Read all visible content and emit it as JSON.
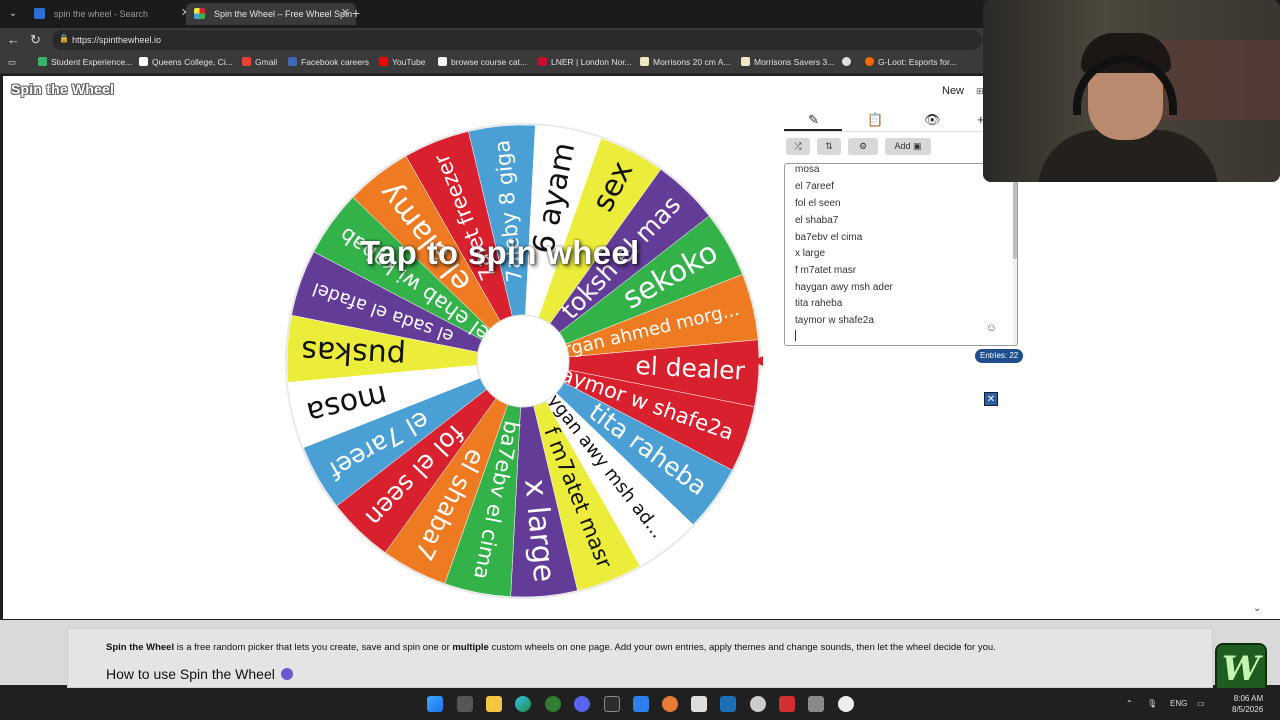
{
  "browser": {
    "tabs": [
      {
        "title": "spin the wheel - Search",
        "active": false
      },
      {
        "title": "Spin the Wheel – Free Wheel Spin",
        "active": true
      }
    ],
    "url": "https://spinthewheel.io",
    "bookmarks": [
      {
        "label": "Student Experience...",
        "color": "#3bb36a"
      },
      {
        "label": "Queens College, Ci...",
        "color": "#ffffff"
      },
      {
        "label": "Gmail",
        "color": "#ea4335"
      },
      {
        "label": "Facebook careers",
        "color": "#4267b2"
      },
      {
        "label": "YouTube",
        "color": "#ff0000"
      },
      {
        "label": "browse course cat...",
        "color": "#f5f5f5"
      },
      {
        "label": "LNER | London Nor...",
        "color": "#c8102e"
      },
      {
        "label": "Morrisons 20 cm A...",
        "color": "#f2e8c5"
      },
      {
        "label": "Morrisons Savers 3...",
        "color": "#f2e8c5"
      },
      {
        "label": "",
        "color": "#e0e0e0"
      },
      {
        "label": "G-Loot: Esports for...",
        "color": "#ff6a00"
      }
    ]
  },
  "app": {
    "logo": "Spin the Wheel",
    "new_label": "New",
    "spin_hint": "Tap to spin wheel",
    "add_button": "Add",
    "entries_count_label": "Entries: 22",
    "entries": [
      "mosa",
      "el 7areef",
      "fol el seen",
      "el shaba7",
      "ba7ebv el cima",
      "x large",
      "f m7atet masr",
      "haygan awy msh ader",
      "tita raheba",
      "taymor w shafe2a"
    ],
    "wheel_segments": [
      {
        "label": "el dealer",
        "color": "#d9202e"
      },
      {
        "label": "taymor w shafe2a",
        "color": "#d9202e"
      },
      {
        "label": "tita raheba",
        "color": "#4aa0d5"
      },
      {
        "label": "haygan awy msh ad...",
        "color": "#ffffff"
      },
      {
        "label": "f m7atet masr",
        "color": "#ecec3a"
      },
      {
        "label": "x large",
        "color": "#633c97"
      },
      {
        "label": "ba7ebv el cima",
        "color": "#33b24a"
      },
      {
        "label": "el shaba7",
        "color": "#ee7b22"
      },
      {
        "label": "fol el seen",
        "color": "#d9202e"
      },
      {
        "label": "el 7areef",
        "color": "#4aa0d5"
      },
      {
        "label": "mosa",
        "color": "#ffffff"
      },
      {
        "label": "puskas",
        "color": "#ecec3a"
      },
      {
        "label": "el sada el afadel",
        "color": "#633c97"
      },
      {
        "label": "el ehab wi kabab",
        "color": "#33b24a"
      },
      {
        "label": "el alamy",
        "color": "#ee7b22"
      },
      {
        "label": "7alet freezer",
        "color": "#d9202e"
      },
      {
        "label": "7aleby 8 giga",
        "color": "#4aa0d5"
      },
      {
        "label": "6 ayam",
        "color": "#ffffff"
      },
      {
        "label": "sex",
        "color": "#ecec3a"
      },
      {
        "label": "toksh el mas",
        "color": "#633c97"
      },
      {
        "label": "sekoko",
        "color": "#33b24a"
      },
      {
        "label": "morgan ahmed morg...",
        "color": "#ee7b22"
      }
    ],
    "pointer_color": "#d9202e"
  },
  "footer": {
    "desc_bold": "Spin the Wheel",
    "desc_mid": " is a free random picker that lets you create, save and spin one or ",
    "desc_bold2": "multiple",
    "desc_end": " custom wheels on one page. Add your own entries, apply themes and change sounds, then let the wheel decide for you.",
    "heading": "How to use Spin the Wheel"
  },
  "taskbar": {
    "lang": "ENG",
    "time": "8:06 AM",
    "date": "8/5/2026"
  },
  "overlay_logo": "W"
}
